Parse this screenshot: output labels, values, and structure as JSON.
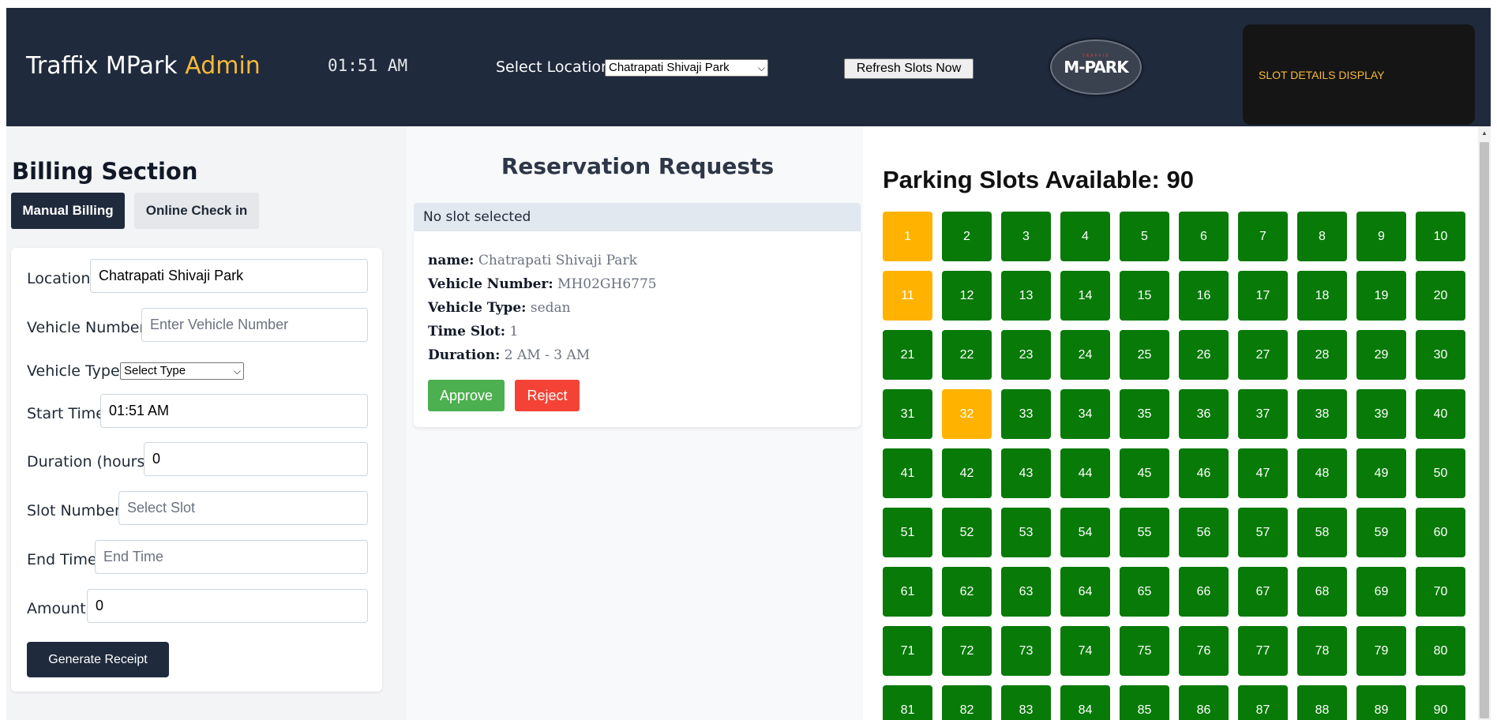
{
  "header": {
    "brand_main": "Traffix MPark",
    "brand_accent": "Admin",
    "clock": "01:51 AM",
    "location_label": "Select Location:",
    "location_selected": "Chatrapati Shivaji Park",
    "refresh_label": "Refresh Slots Now",
    "logo_text": "M-PARK",
    "logo_small": "TRAFFIX",
    "slot_display": "SLOT DETAILS DISPLAY"
  },
  "billing": {
    "title": "Billing Section",
    "tabs": [
      "Manual Billing",
      "Online Check in"
    ],
    "fields": {
      "location": {
        "label": "Location:",
        "value": "Chatrapati Shivaji Park"
      },
      "vehicle_number": {
        "label": "Vehicle Number:",
        "placeholder": "Enter Vehicle Number"
      },
      "vehicle_type": {
        "label": "Vehicle Type:",
        "value": "Select Type"
      },
      "start_time": {
        "label": "Start Time:",
        "value": "01:51 AM"
      },
      "duration": {
        "label": "Duration (hours):",
        "value": "0"
      },
      "slot_number": {
        "label": "Slot Number:",
        "placeholder": "Select Slot"
      },
      "end_time": {
        "label": "End Time:",
        "placeholder": "End Time"
      },
      "amount": {
        "label": "Amount:",
        "value": "0"
      }
    },
    "generate_label": "Generate Receipt"
  },
  "reservations": {
    "title": "Reservation Requests",
    "status": "No slot selected",
    "request": {
      "name_label": "name:",
      "name": "Chatrapati Shivaji Park",
      "vehicle_number_label": "Vehicle Number:",
      "vehicle_number": "MH02GH6775",
      "vehicle_type_label": "Vehicle Type:",
      "vehicle_type": "sedan",
      "time_slot_label": "Time Slot:",
      "time_slot": "1",
      "duration_label": "Duration:",
      "duration": "2 AM - 3 AM"
    },
    "approve_label": "Approve",
    "reject_label": "Reject"
  },
  "slots": {
    "title": "Parking Slots Available: 90",
    "total": 90,
    "reserved": [
      1,
      11,
      32
    ],
    "colors": {
      "available": "#087a08",
      "reserved": "#ffb300"
    }
  },
  "icons": {
    "chevron": "chevron-down-icon"
  }
}
